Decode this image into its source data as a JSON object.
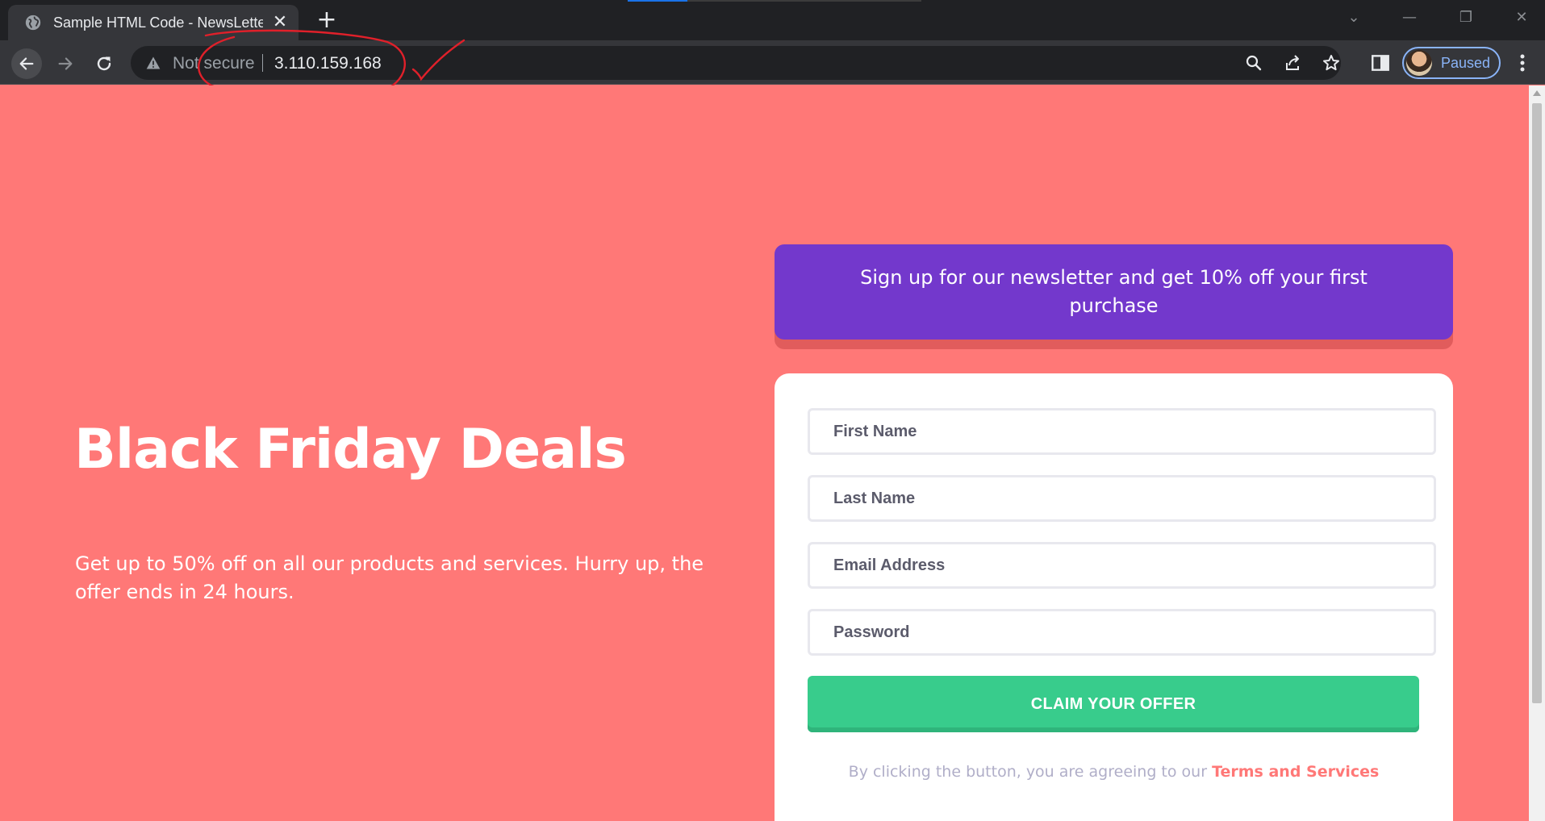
{
  "browser": {
    "tab_title": "Sample HTML Code - NewsLetter",
    "new_tab_label": "+",
    "close_tab_label": "✕",
    "security_label": "Not secure",
    "url": "3.110.159.168",
    "profile_label": "Paused",
    "window_controls": {
      "dropdown": "⌄",
      "minimize": "—",
      "restore": "❐",
      "close": "✕"
    }
  },
  "page": {
    "hero": {
      "title": "Black Friday Deals",
      "subtitle": "Get up to 50% off on all our products and services. Hurry up, the offer ends in 24 hours."
    },
    "banner": {
      "text": "Sign up for our newsletter and get 10% off your first purchase"
    },
    "form": {
      "first_name_placeholder": "First Name",
      "last_name_placeholder": "Last Name",
      "email_placeholder": "Email Address",
      "password_placeholder": "Password",
      "submit_label": "CLAIM YOUR OFFER",
      "terms_prefix": "By clicking the button, you are agreeing to our ",
      "terms_link": "Terms and Services"
    }
  },
  "colors": {
    "page_background": "#ff7877",
    "banner": "#7338cc",
    "button": "#38cc8c",
    "annotation": "#e0202a"
  }
}
